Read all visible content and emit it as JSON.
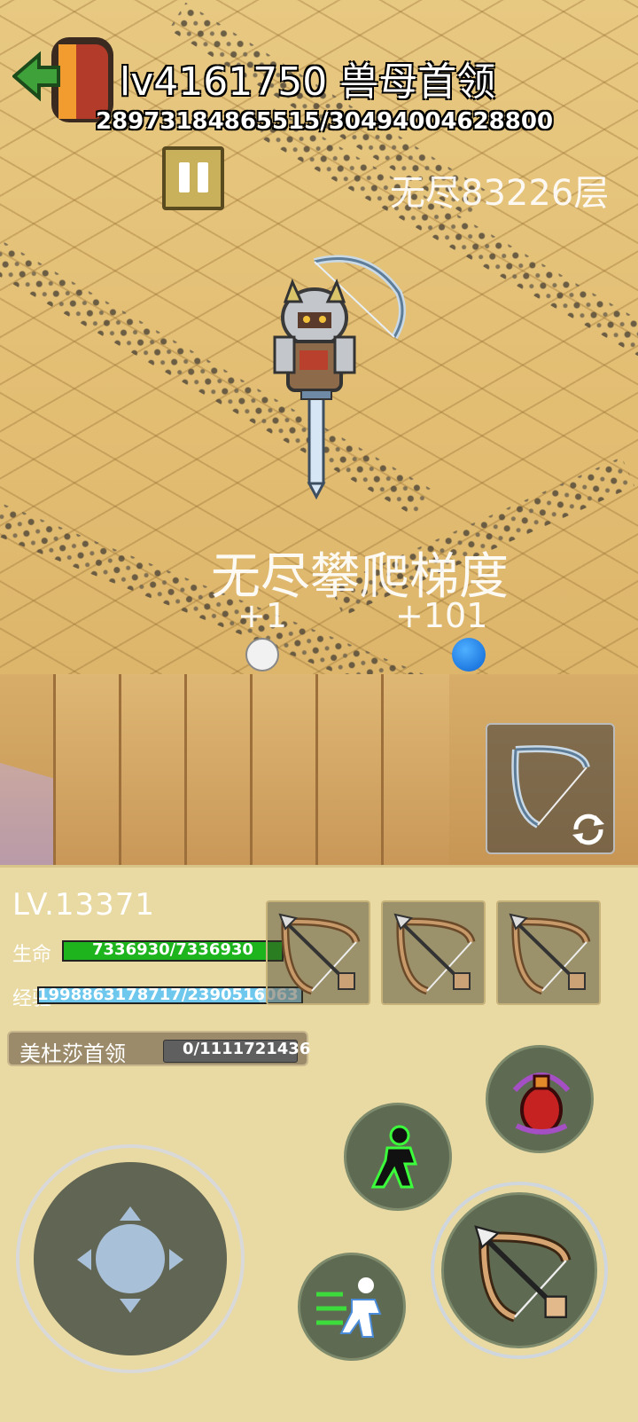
{
  "hud": {
    "boss_title": "lv4161750 兽母首领",
    "boss_hp": "28973184865515/30494004628800",
    "floor_label": "无尽83226层",
    "pause_icon": "pause-icon",
    "back_icon": "exit-door-icon"
  },
  "scene": {
    "climb_title": "无尽攀爬梯度",
    "left_bonus": "+1",
    "right_bonus": "+101"
  },
  "player": {
    "level": "LV.13371",
    "hp_label": "生命",
    "hp_value": "7336930/7336930",
    "hp_fraction": 1.0,
    "xp_label": "经验",
    "xp_value": "1998863178717/2390516063",
    "xp_fraction": 0.84
  },
  "quest": {
    "name": "美杜莎首领",
    "progress": "0/1111721436",
    "progress_fraction": 0.0
  },
  "skills": {
    "slots": [
      "bow-icon",
      "bow-icon",
      "bow-icon"
    ],
    "potion_icon": "potion-icon",
    "dash_icon": "dash-icon",
    "sprint_icon": "sprint-icon",
    "attack_icon": "bow-icon",
    "swap_icon": "swap-icon"
  },
  "colors": {
    "hp_bar": "#1db41d",
    "xp_bar": "#6ec7ec",
    "panel": "#e9d9a3",
    "button": "#5f6a52"
  }
}
